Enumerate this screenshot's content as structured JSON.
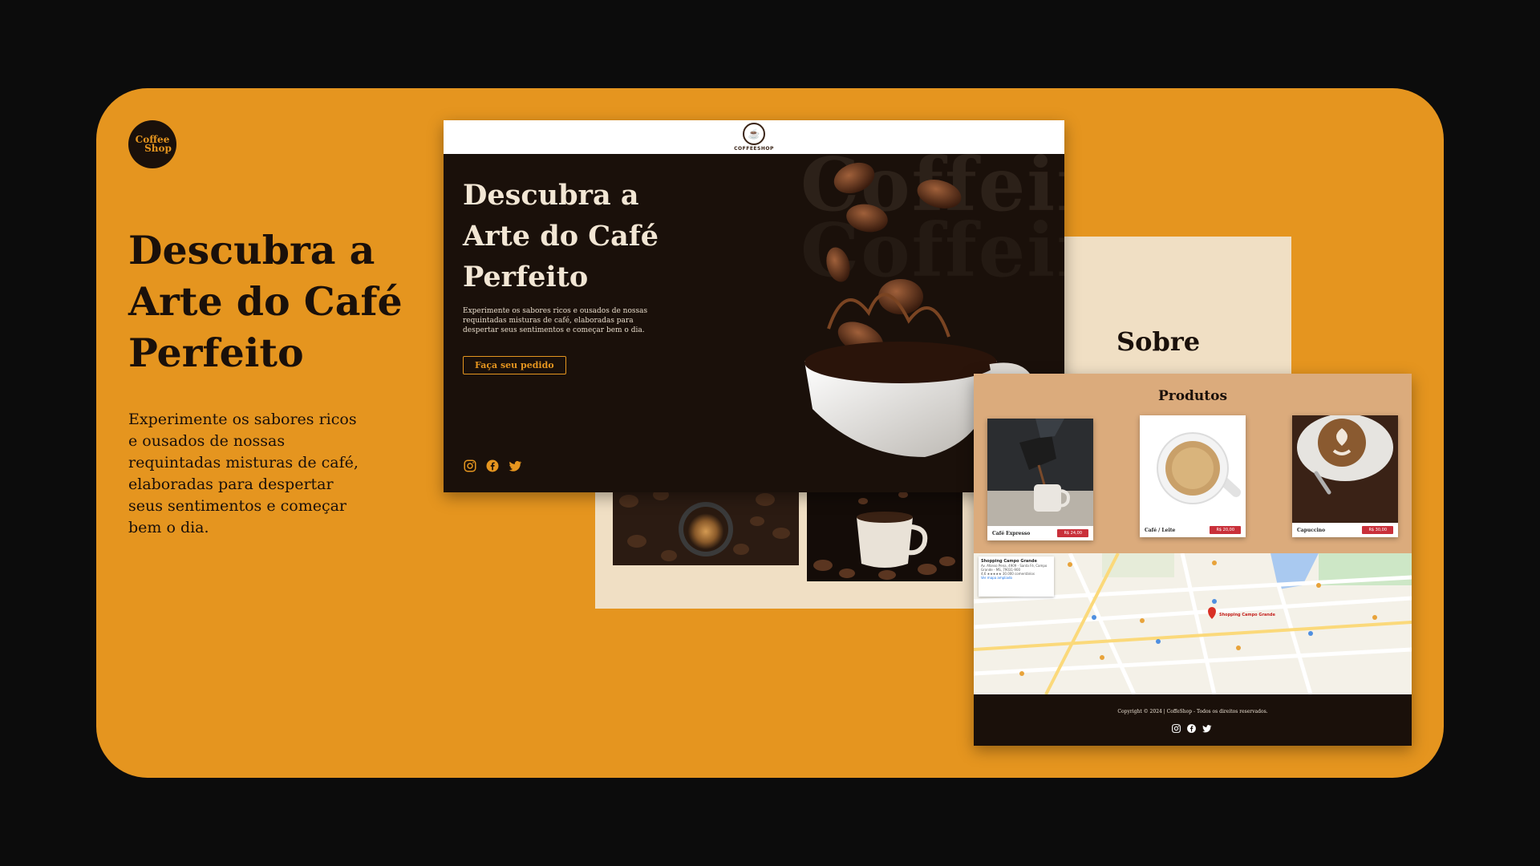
{
  "slide": {
    "logo": {
      "line1": "Coffee",
      "line2": "Shop"
    },
    "title": "Descubra a Arte do Café Perfeito",
    "description": "Experimente os sabores ricos e ousados de nossas requintadas misturas de café, elaboradas para despertar seus sentimentos e começar bem o dia."
  },
  "hero_window": {
    "brand": "COFFEESHOP",
    "title": "Descubra a Arte do Café Perfeito",
    "description": "Experimente os sabores ricos e ousados de nossas requintadas misturas de café, elaboradas para despertar seus sentimentos e começar bem o dia.",
    "cta_label": "Faça seu pedido",
    "watermark": "Coffein",
    "social_icons": [
      "instagram-icon",
      "facebook-icon",
      "twitter-icon"
    ]
  },
  "about_window": {
    "title": "Sobre"
  },
  "products_window": {
    "title": "Produtos",
    "products": [
      {
        "name": "Café Expresso",
        "price": "R$ 24,00"
      },
      {
        "name": "Café / Leite",
        "price": "R$ 20,00"
      },
      {
        "name": "Capuccino",
        "price": "R$ 30,00"
      }
    ],
    "map": {
      "place_name": "Shopping Campo Grande",
      "address": "Av. Afonso Pena, 4909 - Santa Fé, Campo Grande - MS, 79031-900",
      "rating": "4,6 ★★★★★ 30.000 comentários",
      "link": "Ver mapa ampliado",
      "pin_label": "Shopping Campo Grande"
    },
    "footer": {
      "copyright": "Copyright © 2024 | CoffeShop - Todos os direitos reservados."
    }
  },
  "colors": {
    "background": "#0c0c0c",
    "card": "#e5951f",
    "dark": "#1a100a",
    "cream": "#f0dfc4",
    "price_red": "#c9303a"
  }
}
